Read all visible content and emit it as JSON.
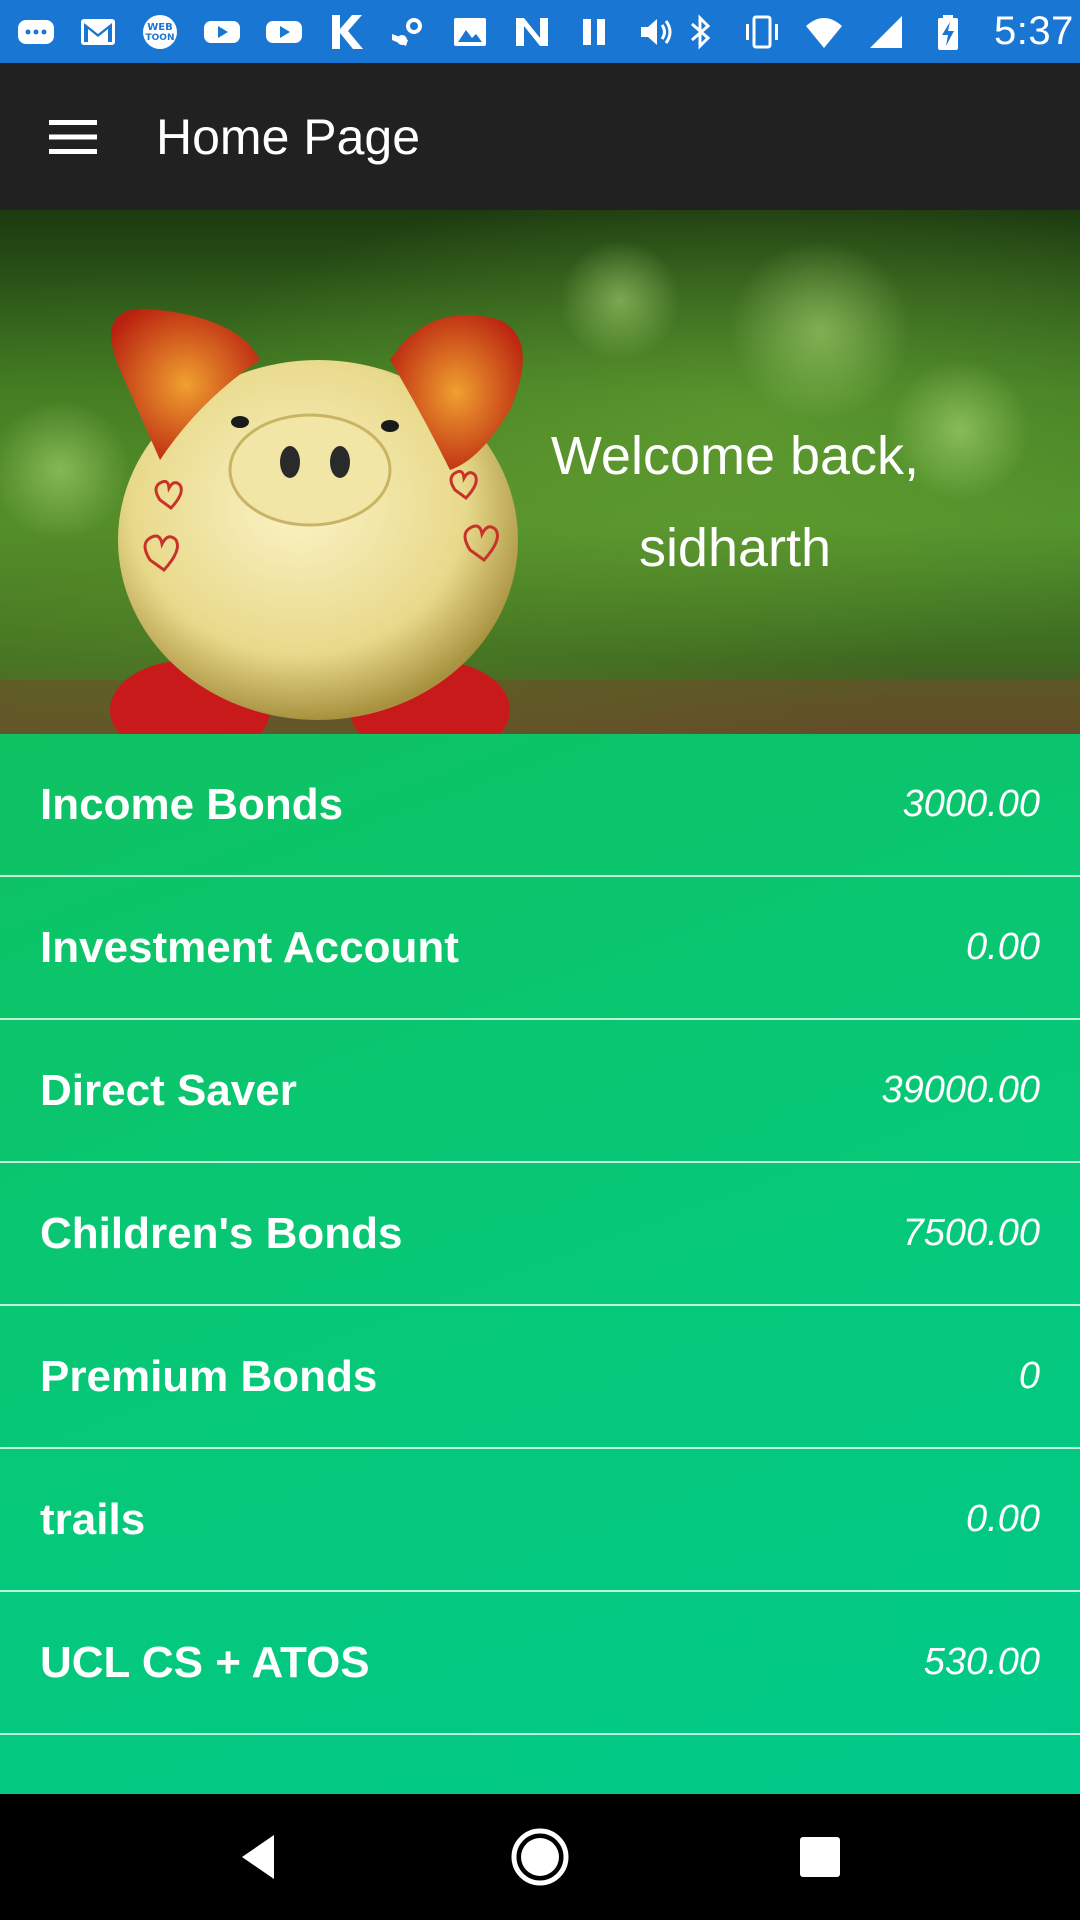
{
  "status_bar": {
    "time": "5:37",
    "left_icons": [
      "chat-icon",
      "gmail-icon",
      "webtoon-icon",
      "youtube-icon",
      "youtube-icon",
      "k-icon",
      "steam-icon",
      "image-icon",
      "n-icon",
      "pause-icon",
      "volume-icon"
    ],
    "right_icons": [
      "bluetooth-icon",
      "vibrate-icon",
      "wifi-icon",
      "signal-icon",
      "battery-charging-icon"
    ],
    "background": "#1976d2"
  },
  "app_bar": {
    "title": "Home Page",
    "background": "#212121"
  },
  "hero": {
    "welcome_line1": "Welcome back,",
    "welcome_line2": "sidharth",
    "image": "piggy-bank-on-grass"
  },
  "accounts": [
    {
      "name": "Income Bonds",
      "value": "3000.00"
    },
    {
      "name": "Investment Account",
      "value": "0.00"
    },
    {
      "name": "Direct Saver",
      "value": "39000.00"
    },
    {
      "name": "Children's Bonds",
      "value": "7500.00"
    },
    {
      "name": "Premium Bonds",
      "value": "0"
    },
    {
      "name": "trails",
      "value": "0.00"
    },
    {
      "name": "UCL CS + ATOS",
      "value": "530.00"
    }
  ],
  "colors": {
    "list_gradient_start": "#0fc262",
    "list_gradient_end": "#00c98a"
  },
  "nav_bar": {
    "back": "back-icon",
    "home": "home-icon",
    "recents": "recents-icon"
  }
}
